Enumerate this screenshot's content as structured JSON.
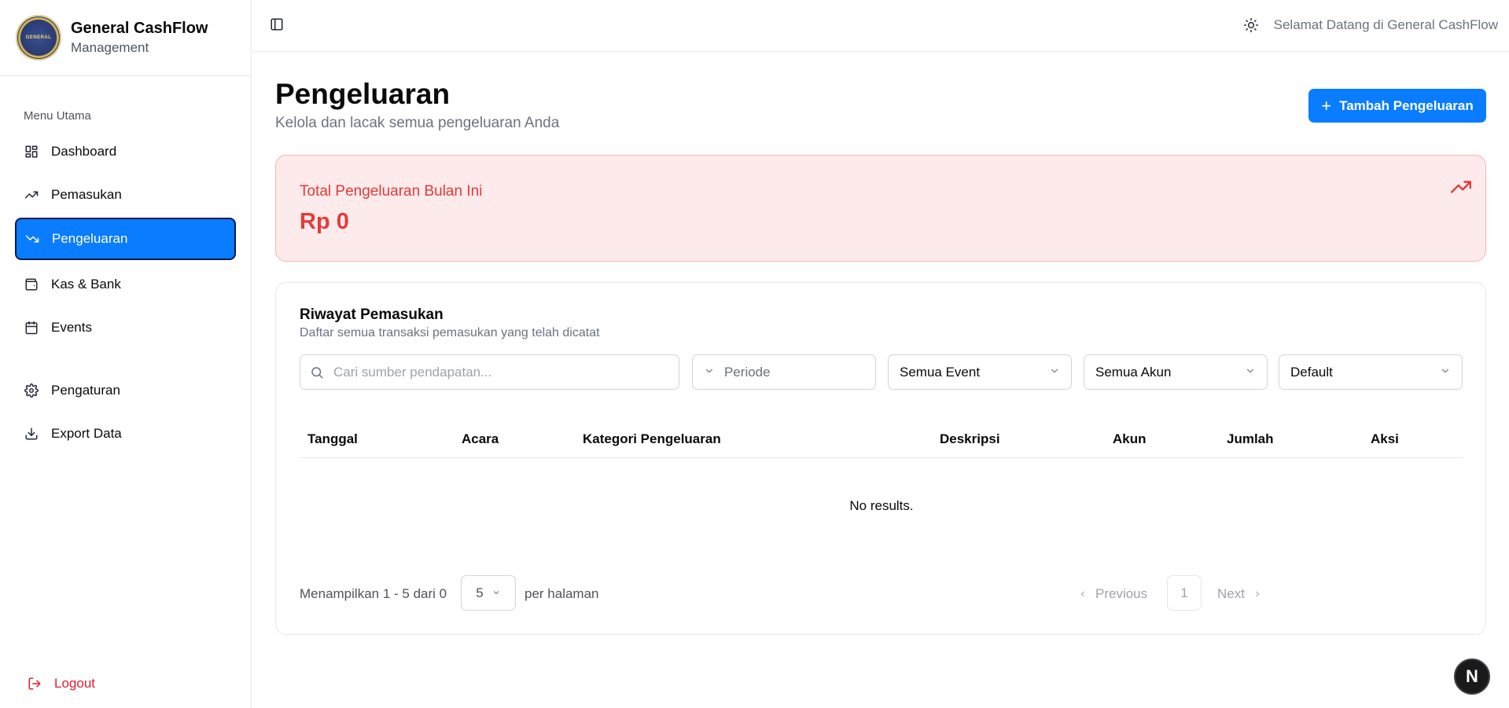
{
  "brand": {
    "title": "General CashFlow",
    "subtitle": "Management",
    "logo_text": "GENERAL"
  },
  "sidebar": {
    "menu_label": "Menu Utama",
    "items": [
      {
        "label": "Dashboard",
        "icon": "dashboard-icon"
      },
      {
        "label": "Pemasukan",
        "icon": "trending-up-icon"
      },
      {
        "label": "Pengeluaran",
        "icon": "trending-down-icon",
        "active": true
      },
      {
        "label": "Kas & Bank",
        "icon": "wallet-icon"
      },
      {
        "label": "Events",
        "icon": "calendar-icon"
      },
      {
        "label": "Pengaturan",
        "icon": "gear-icon"
      },
      {
        "label": "Export Data",
        "icon": "download-icon"
      }
    ],
    "logout_label": "Logout"
  },
  "topbar": {
    "welcome": "Selamat Datang di General CashFlow"
  },
  "page": {
    "title": "Pengeluaran",
    "subtitle": "Kelola dan lacak semua pengeluaran Anda",
    "add_button": "Tambah Pengeluaran"
  },
  "summary": {
    "label": "Total Pengeluaran Bulan Ini",
    "value": "Rp 0"
  },
  "history": {
    "title": "Riwayat Pemasukan",
    "subtitle": "Daftar semua transaksi pemasukan yang telah dicatat",
    "search_placeholder": "Cari sumber pendapatan...",
    "filters": {
      "periode": "Periode",
      "event": "Semua Event",
      "akun": "Semua Akun",
      "sort": "Default"
    },
    "columns": [
      "Tanggal",
      "Acara",
      "Kategori Pengeluaran",
      "Deskripsi",
      "Akun",
      "Jumlah",
      "Aksi"
    ],
    "empty": "No results.",
    "pagination": {
      "showing": "Menampilkan 1 - 5 dari 0",
      "per_page_value": "5",
      "per_page_label": "per halaman",
      "previous": "Previous",
      "page": "1",
      "next": "Next"
    }
  },
  "colors": {
    "accent": "#0a7cff",
    "danger": "#e23b3b",
    "summary_bg": "#fdeaea"
  },
  "badge": {
    "text": "N"
  }
}
